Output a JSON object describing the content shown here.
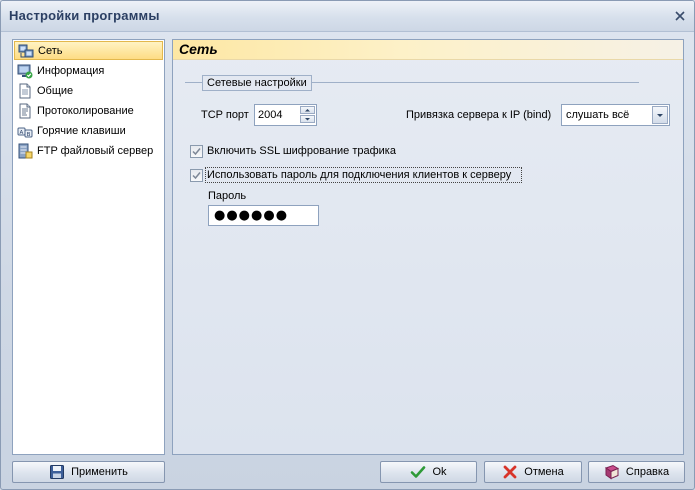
{
  "window": {
    "title": "Настройки программы"
  },
  "sidebar": {
    "items": [
      {
        "label": "Сеть",
        "icon": "network-icon",
        "selected": true
      },
      {
        "label": "Информация",
        "icon": "info-monitor-icon",
        "selected": false
      },
      {
        "label": "Общие",
        "icon": "document-icon",
        "selected": false
      },
      {
        "label": "Протоколирование",
        "icon": "log-icon",
        "selected": false
      },
      {
        "label": "Горячие клавиши",
        "icon": "hotkeys-icon",
        "selected": false
      },
      {
        "label": "FTP файловый сервер",
        "icon": "ftp-server-icon",
        "selected": false
      }
    ]
  },
  "panel": {
    "title": "Сеть",
    "group_title": "Сетевые настройки",
    "tcp_port_label": "TCP порт",
    "tcp_port_value": "2004",
    "bind_label": "Привязка сервера к IP (bind)",
    "bind_value": "слушать всё",
    "ssl_label": "Включить SSL шифрование трафика",
    "ssl_checked": true,
    "use_password_label": "Использовать пароль для подключения клиентов к серверу",
    "use_password_checked": true,
    "password_label": "Пароль",
    "password_value": "●●●●●●"
  },
  "buttons": {
    "apply": "Применить",
    "ok": "Ok",
    "cancel": "Отмена",
    "help": "Справка"
  },
  "colors": {
    "selected_bg": "#fedc84",
    "border": "#8ea2be",
    "title": "#2b3f63"
  }
}
